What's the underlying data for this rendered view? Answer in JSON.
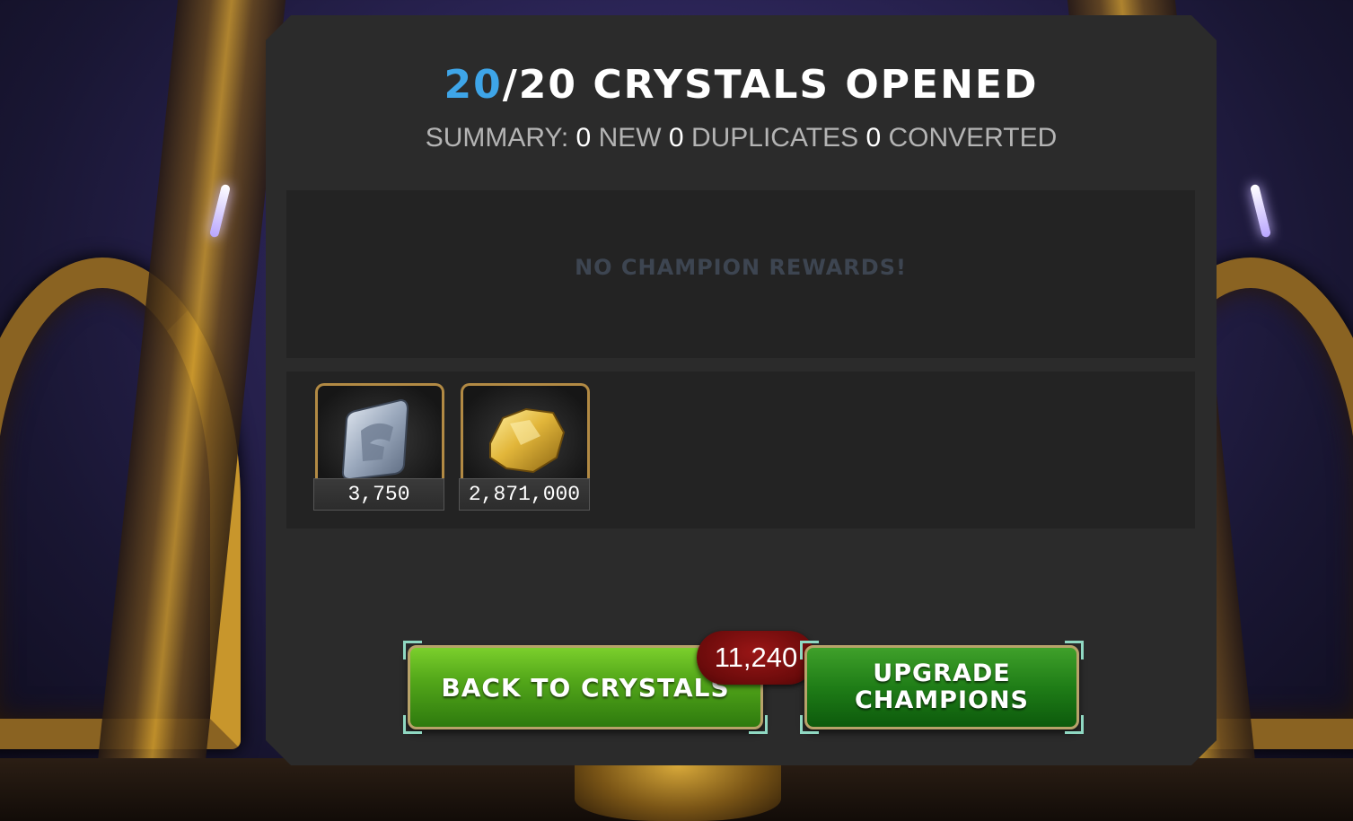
{
  "header": {
    "opened_count": "20",
    "total_count": "/20",
    "title_suffix": " CRYSTALS OPENED"
  },
  "summary": {
    "label": "SUMMARY:",
    "new_count": "0",
    "new_label": "NEW",
    "duplicates_count": "0",
    "duplicates_label": "DUPLICATES",
    "converted_count": "0",
    "converted_label": "CONVERTED"
  },
  "champion_rewards": {
    "empty_message": "NO CHAMPION REWARDS!"
  },
  "items": [
    {
      "icon": "iso-8-shard-icon",
      "quantity": "3,750"
    },
    {
      "icon": "gold-nugget-icon",
      "quantity": "2,871,000"
    }
  ],
  "buttons": {
    "back_label": "BACK TO CRYSTALS",
    "upgrade_line1": "UPGRADE",
    "upgrade_line2": "CHAMPIONS"
  },
  "badge": {
    "count": "11,240"
  },
  "colors": {
    "highlight": "#3ea5e8",
    "panel": "#2b2b2b",
    "button_green": "#54a81a",
    "badge_red": "#8a1414"
  }
}
